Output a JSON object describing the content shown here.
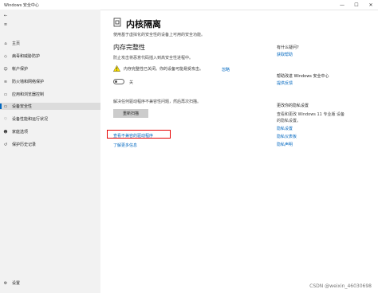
{
  "window": {
    "title": "Windows 安全中心",
    "minimize": "—",
    "maximize": "☐",
    "close": "✕"
  },
  "sidebar": {
    "back": "←",
    "menu": "≡",
    "items": [
      {
        "label": "主页",
        "icon": "home-icon",
        "glyph": "⌂"
      },
      {
        "label": "病毒和威胁防护",
        "icon": "shield-icon",
        "glyph": "◇"
      },
      {
        "label": "帐户保护",
        "icon": "person-icon",
        "glyph": "☺"
      },
      {
        "label": "防火墙和网络保护",
        "icon": "wifi-icon",
        "glyph": "≋"
      },
      {
        "label": "应用和浏览器控制",
        "icon": "app-window-icon",
        "glyph": "▭"
      },
      {
        "label": "设备安全性",
        "icon": "laptop-icon",
        "glyph": "▭"
      },
      {
        "label": "设备性能和运行状况",
        "icon": "heart-icon",
        "glyph": "♡"
      },
      {
        "label": "家庭选项",
        "icon": "family-icon",
        "glyph": "☻"
      },
      {
        "label": "保护历史记录",
        "icon": "history-icon",
        "glyph": "↺"
      }
    ],
    "active_index": 5,
    "settings": {
      "label": "设置",
      "glyph": "⚙"
    }
  },
  "main": {
    "title": "内核隔离",
    "description": "使用基于虚拟化的安全性的设备上可用的安全功能。",
    "section": {
      "heading": "内存完整性",
      "description": "防止攻击将恶意代码插入到高安全性进程中。",
      "warning": "内存完整性已关闭。你的设备可能易受攻击。",
      "learn_more": "忽略",
      "toggle_state": "关"
    },
    "incompatible_note": "解决任何驱动程序不兼容性问题，然后再次扫描。",
    "scan_button": "重新扫描",
    "link_drivers": "查看不兼容的驱动程序",
    "link_learn": "了解更多信息"
  },
  "right_panel": {
    "q_heading": "有什么疑问?",
    "q_link": "获取帮助",
    "improve_heading": "帮助改进 Windows 安全中心",
    "improve_link": "提供反馈",
    "privacy_heading": "更改你的隐私设置",
    "privacy_desc_1": "查看和更改 Windows 11 专业版 设备",
    "privacy_desc_2": "的隐私设置。",
    "privacy_links": [
      "隐私设置",
      "隐私仪表板",
      "隐私声明"
    ]
  },
  "watermark": "CSDN @weixin_46030698",
  "colors": {
    "accent": "#0067c0",
    "highlight_box": "#e60000",
    "warning": "#fce100"
  }
}
